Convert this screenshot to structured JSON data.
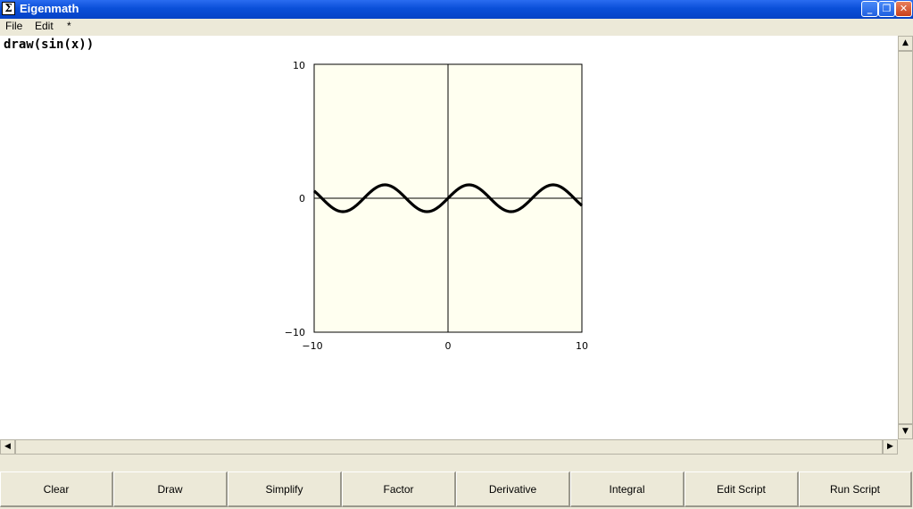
{
  "window": {
    "title": "Eigenmath",
    "icon": "sigma-icon",
    "app_icon_glyph": "Σ",
    "min_glyph": "_",
    "max_glyph": "❐",
    "close_glyph": "✕"
  },
  "menu": [
    "File",
    "Edit",
    "*"
  ],
  "command": "draw(sin(x))",
  "scroll": {
    "up": "▲",
    "down": "▼",
    "left": "◀",
    "right": "▶"
  },
  "toolbar": [
    "Clear",
    "Draw",
    "Simplify",
    "Factor",
    "Derivative",
    "Integral",
    "Edit Script",
    "Run Script"
  ],
  "colors": {
    "plot_background": "#fffff0",
    "curve": "#000000",
    "titlebar": "#0a4fd8"
  },
  "chart_data": {
    "type": "line",
    "function": "sin(x)",
    "xlim": [
      -10,
      10
    ],
    "ylim": [
      -10,
      10
    ],
    "x_ticks": [
      "−10",
      "0",
      "10"
    ],
    "y_ticks": [
      "10",
      "0",
      "−10"
    ],
    "title": "",
    "xlabel": "",
    "ylabel": ""
  }
}
